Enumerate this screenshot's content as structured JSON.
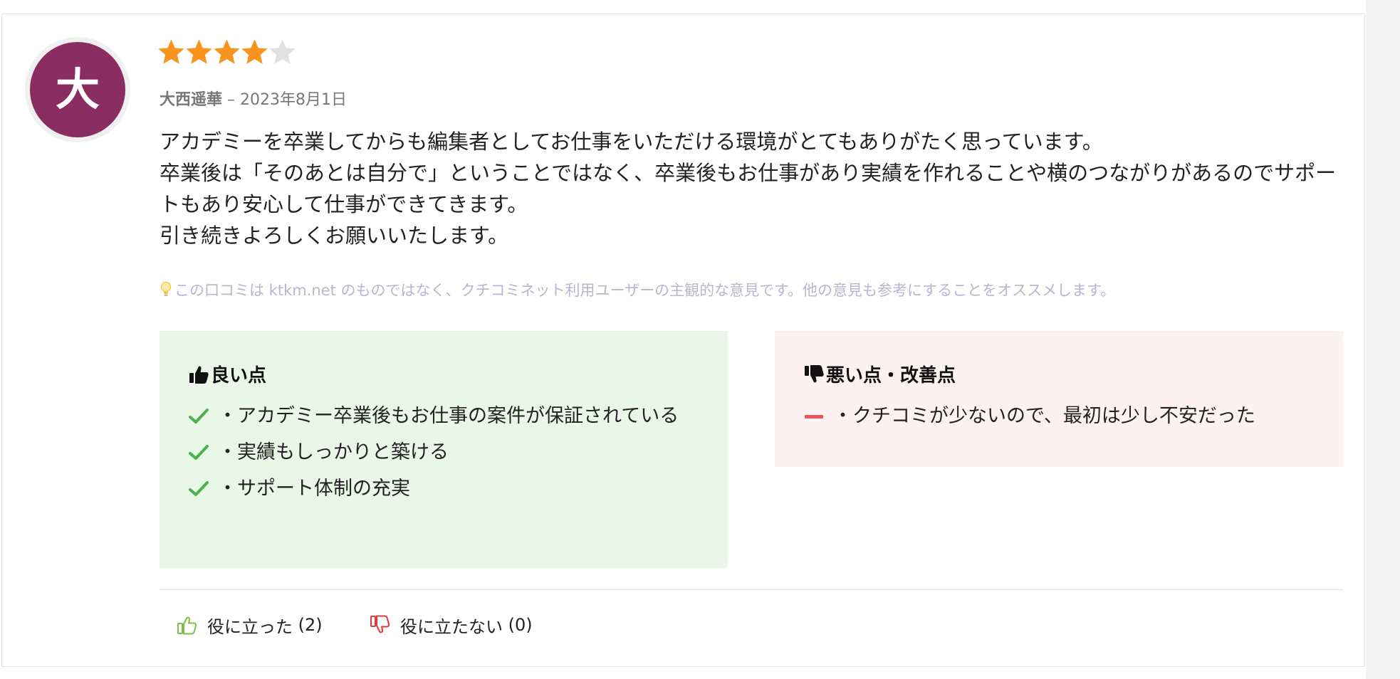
{
  "review": {
    "avatar_initial": "大",
    "rating": 4,
    "rating_max": 5,
    "author": "大西遥華",
    "separator": " – ",
    "date": "2023年8月1日",
    "body_lines": [
      "アカデミーを卒業してからも編集者としてお仕事をいただける環境がとてもありがたく思っています。",
      "卒業後は「そのあとは自分で」ということではなく、卒業後もお仕事があり実績を作れることや横のつながりがあるのでサポートもあり安心して仕事ができてきます。",
      "引き続きよろしくお願いいたします。"
    ],
    "disclaimer": "この口コミは ktkm.net のものではなく、クチコミネット利用ユーザーの主観的な意見です。他の意見も参考にすることをオススメします。",
    "pros": {
      "title": "良い点",
      "items": [
        "・アカデミー卒業後もお仕事の案件が保証されている",
        "・実績もしっかりと築ける",
        "・サポート体制の充実"
      ]
    },
    "cons": {
      "title": "悪い点・改善点",
      "items": [
        "・クチコミが少ないので、最初は少し不安だった"
      ]
    },
    "helpful": {
      "label": "役に立った",
      "count": "(2)"
    },
    "not_helpful": {
      "label": "役に立たない",
      "count": "(0)"
    }
  },
  "colors": {
    "avatar_bg": "#8a2e62",
    "star_filled": "#f7941d",
    "star_empty": "#e2e0e2",
    "pros_bg": "#e9f7e6",
    "cons_bg": "#fdf1f1",
    "check": "#4caf50",
    "minus": "#e9555c",
    "disclaimer_text": "#b9b6cd",
    "thumb_up": "#7bc043",
    "thumb_down": "#e53935"
  },
  "icons": {
    "rating": "star-icon",
    "disclaimer": "lightbulb-icon",
    "pros": "thumbs-up-icon",
    "cons": "thumbs-down-icon",
    "pro_item": "check-icon",
    "con_item": "minus-icon"
  }
}
